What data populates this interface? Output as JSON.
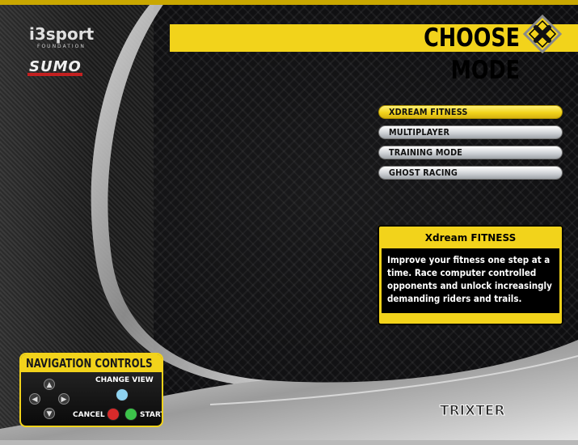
{
  "header": {
    "title": "CHOOSE MODE",
    "accent_color": "#f2d31b"
  },
  "logos": {
    "i3sport": "i3sport",
    "i3sport_sub": "FOUNDATION",
    "sumo": "SUMO",
    "trixter": "TRIXTER"
  },
  "menu": {
    "items": [
      {
        "label": "XDREAM FITNESS",
        "selected": true
      },
      {
        "label": "MULTIPLAYER",
        "selected": false
      },
      {
        "label": "TRAINING MODE",
        "selected": false
      },
      {
        "label": "GHOST RACING",
        "selected": false
      }
    ]
  },
  "description": {
    "title": "Xdream FITNESS",
    "body": "Improve your fitness one step at a time. Race computer controlled opponents and unlock increasingly demanding riders and trails."
  },
  "nav_controls": {
    "title": "NAVIGATION CONTROLS",
    "change_view": "CHANGE VIEW",
    "cancel": "CANCEL",
    "start": "START",
    "colors": {
      "change_view": "#8fd3f0",
      "cancel": "#d62a2a",
      "start": "#3cc24a"
    }
  }
}
